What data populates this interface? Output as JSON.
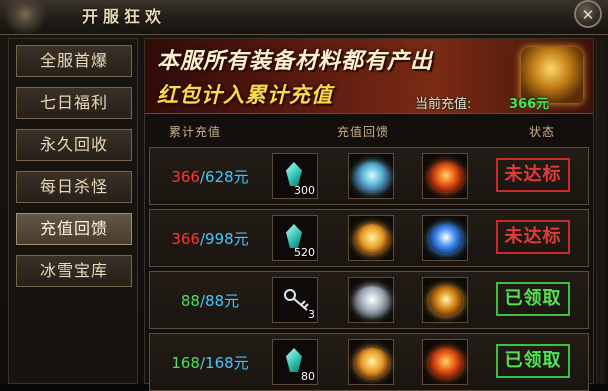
{
  "window": {
    "title": "开服狂欢",
    "close_symbol": "✕"
  },
  "sidebar": {
    "items": [
      {
        "label": "全服首爆",
        "active": false
      },
      {
        "label": "七日福利",
        "active": false
      },
      {
        "label": "永久回收",
        "active": false
      },
      {
        "label": "每日杀怪",
        "active": false
      },
      {
        "label": "充值回馈",
        "active": true
      },
      {
        "label": "冰雪宝库",
        "active": false
      }
    ]
  },
  "banner": {
    "line1": "本服所有装备材料都有产出",
    "line2": "红包计入累计充值",
    "recharge_label": "当前充值:",
    "recharge_value": "366元"
  },
  "table": {
    "headers": [
      "累计充值",
      "充值回馈",
      "状态"
    ],
    "rows": [
      {
        "current": "366",
        "target": "628元",
        "done": false,
        "rewards": [
          {
            "icon": "teal-gem-icon",
            "qty": "300"
          },
          {
            "icon": "blue-crown-icon",
            "qty": ""
          },
          {
            "icon": "red-armor-icon",
            "qty": ""
          }
        ],
        "status": "未达标"
      },
      {
        "current": "366",
        "target": "998元",
        "done": false,
        "rewards": [
          {
            "icon": "teal-gem-icon",
            "qty": "520"
          },
          {
            "icon": "gold-crown-icon",
            "qty": ""
          },
          {
            "icon": "blue-armor-icon",
            "qty": ""
          }
        ],
        "status": "未达标"
      },
      {
        "current": "88",
        "target": "88元",
        "done": true,
        "rewards": [
          {
            "icon": "key-icon",
            "qty": "3"
          },
          {
            "icon": "silver-crown-icon",
            "qty": ""
          },
          {
            "icon": "gold-armor-icon",
            "qty": ""
          }
        ],
        "status": "已领取"
      },
      {
        "current": "168",
        "target": "168元",
        "done": true,
        "rewards": [
          {
            "icon": "teal-gem-icon",
            "qty": "80"
          },
          {
            "icon": "gold-crown-icon",
            "qty": ""
          },
          {
            "icon": "red-armor-icon",
            "qty": ""
          }
        ],
        "status": "已领取"
      }
    ]
  }
}
